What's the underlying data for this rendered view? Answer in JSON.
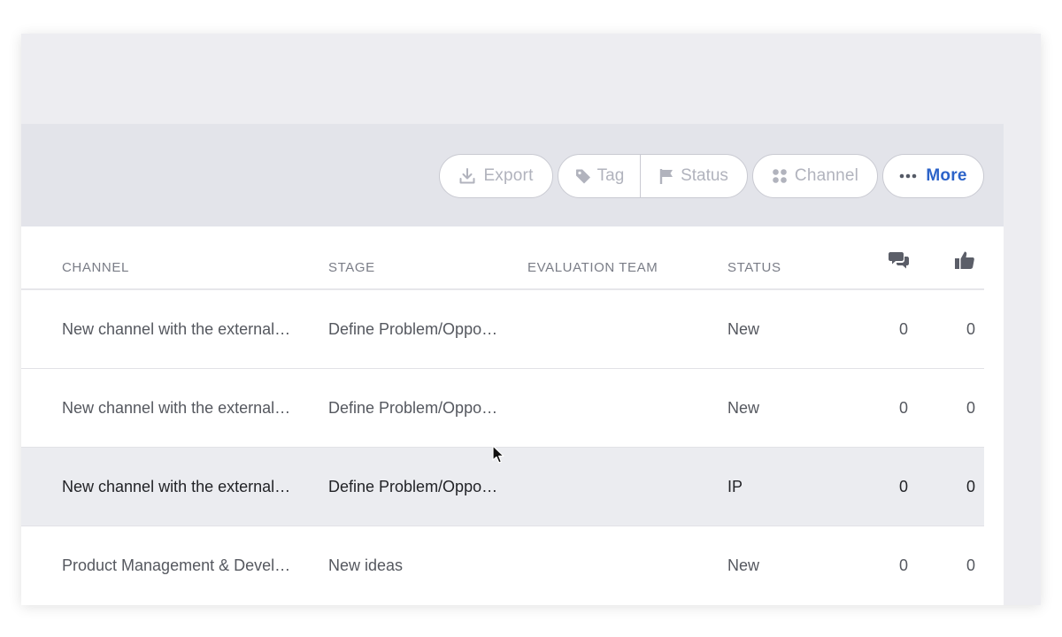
{
  "toolbar": {
    "export_label": "Export",
    "tag_label": "Tag",
    "status_label": "Status",
    "channel_label": "Channel",
    "more_label": "More",
    "icons": {
      "export": "download-icon",
      "tag": "tag-icon",
      "status": "flag-icon",
      "channel": "grid-dots-icon",
      "more": "ellipsis-icon"
    },
    "colors": {
      "disabled_text": "#b1b3bd",
      "more_text": "#2c63c9"
    }
  },
  "table": {
    "headers": {
      "channel": "CHANNEL",
      "stage": "STAGE",
      "evaluation_team": "EVALUATION TEAM",
      "status": "STATUS",
      "comments_icon": "comments-icon",
      "likes_icon": "thumbs-up-icon"
    },
    "rows": [
      {
        "channel": "New channel with the external…",
        "stage": "Define Problem/Oppo…",
        "evaluation_team": "",
        "status": "New",
        "comments": "0",
        "likes": "0"
      },
      {
        "channel": "New channel with the external…",
        "stage": "Define Problem/Oppo…",
        "evaluation_team": "",
        "status": "New",
        "comments": "0",
        "likes": "0"
      },
      {
        "channel": "New channel with the external…",
        "stage": "Define Problem/Oppo…",
        "evaluation_team": "",
        "status": "IP",
        "comments": "0",
        "likes": "0"
      },
      {
        "channel": "Product Management & Devel…",
        "stage": "New ideas",
        "evaluation_team": "",
        "status": "New",
        "comments": "0",
        "likes": "0"
      }
    ]
  }
}
